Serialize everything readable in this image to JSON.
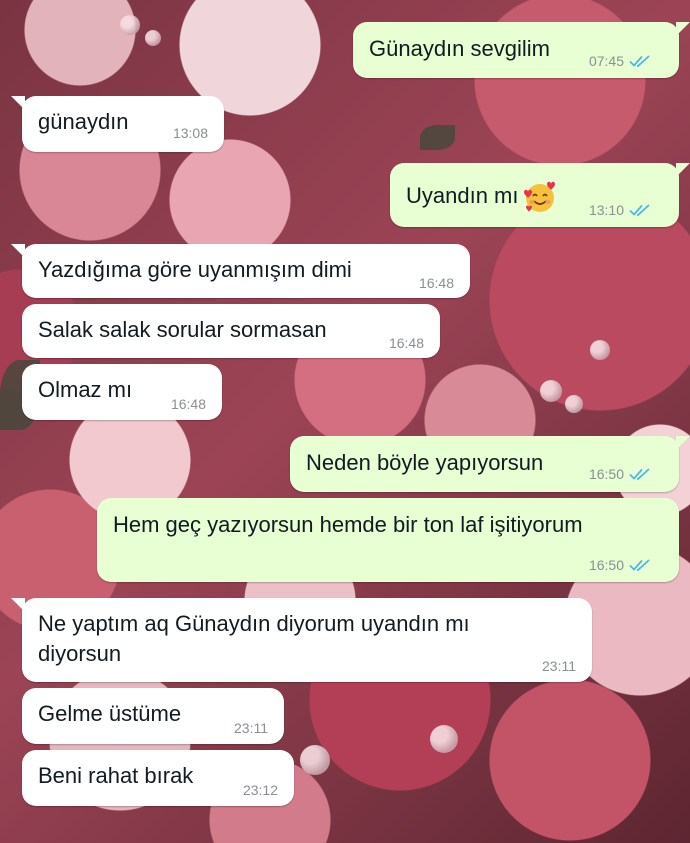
{
  "messages": [
    {
      "direction": "outgoing",
      "text": "Günaydın sevgilim",
      "time": "07:45",
      "ticks": "read-double-check"
    },
    {
      "direction": "incoming",
      "text": "günaydın",
      "time": "13:08"
    },
    {
      "direction": "outgoing",
      "text": "Uyandın mı",
      "emoji": "smiling-face-with-hearts",
      "time": "13:10",
      "ticks": "read-double-check"
    },
    {
      "direction": "incoming",
      "text": "Yazdığıma göre uyanmışım dimi",
      "time": "16:48"
    },
    {
      "direction": "incoming",
      "text": "Salak salak sorular sormasan",
      "time": "16:48"
    },
    {
      "direction": "incoming",
      "text": "Olmaz mı",
      "time": "16:48"
    },
    {
      "direction": "outgoing",
      "text": "Neden böyle yapıyorsun",
      "time": "16:50",
      "ticks": "read-double-check"
    },
    {
      "direction": "outgoing",
      "text": "Hem geç yazıyorsun hemde bir ton laf işitiyorum",
      "time": "16:50",
      "ticks": "read-double-check"
    },
    {
      "direction": "incoming",
      "lines": [
        "Ne yaptım aq Günaydın diyorum uyandın mı",
        "diyorsun"
      ],
      "time": "23:11"
    },
    {
      "direction": "incoming",
      "text": "Gelme üstüme",
      "time": "23:11"
    },
    {
      "direction": "incoming",
      "text": "Beni rahat bırak",
      "time": "23:12"
    }
  ],
  "colors": {
    "incoming_bubble": "#ffffff",
    "outgoing_bubble": "#e8ffd4",
    "read_ticks": "#4fb6ec",
    "timestamp": "#8a8f93",
    "message_text": "#111b21"
  },
  "wallpaper": "pink-roses-flowers"
}
